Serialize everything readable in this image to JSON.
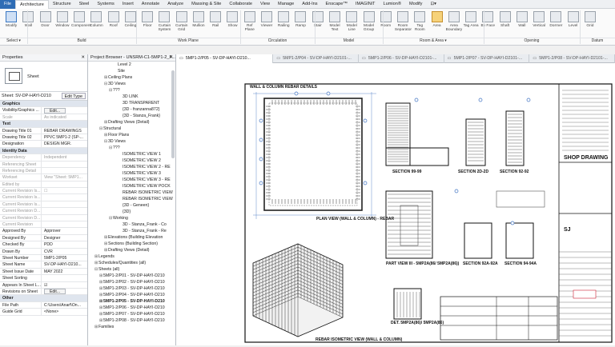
{
  "menu": [
    "File",
    "Architecture",
    "Structure",
    "Steel",
    "Systems",
    "Insert",
    "Annotate",
    "Analyze",
    "Massing & Site",
    "Collaborate",
    "View",
    "Manage",
    "Add-Ins",
    "Enscape™",
    "IMAGINiT",
    "Lumion®",
    "Modify",
    "⊡▾"
  ],
  "ribbon": {
    "tools": [
      {
        "label": "Modify"
      },
      {
        "label": "Wall"
      },
      {
        "label": "Door"
      },
      {
        "label": "Window"
      },
      {
        "label": "Component"
      },
      {
        "label": "Column"
      },
      {
        "label": "Roof"
      },
      {
        "label": "Ceiling"
      },
      {
        "label": "Floor"
      },
      {
        "label": "Curtain System"
      },
      {
        "label": "Curtain Grid"
      },
      {
        "label": "Mullion"
      },
      {
        "label": "Rail"
      },
      {
        "label": "Show"
      },
      {
        "label": "Ref Plane"
      },
      {
        "label": "Viewer"
      },
      {
        "label": "Railing"
      },
      {
        "label": "Ramp"
      },
      {
        "label": "Stair"
      },
      {
        "label": "Model Text"
      },
      {
        "label": "Model Line"
      },
      {
        "label": "Model Group"
      },
      {
        "label": "Room"
      },
      {
        "label": "Room Separator"
      },
      {
        "label": "Tag Room"
      },
      {
        "label": "Area"
      },
      {
        "label": "Area Boundary"
      },
      {
        "label": "Tag Area"
      },
      {
        "label": "By Face"
      },
      {
        "label": "Shaft"
      },
      {
        "label": "Wall"
      },
      {
        "label": "Vertical"
      },
      {
        "label": "Dormer"
      },
      {
        "label": "Level"
      },
      {
        "label": "Grid"
      }
    ],
    "groups": [
      "Select ▾",
      "Build",
      "Work Plane",
      "Circulation",
      "Model",
      "Room & Area ▾",
      "Opening",
      "Datum"
    ]
  },
  "properties": {
    "title": "Properties",
    "type_name": "Sheet",
    "selector": "Sheet: SV-DP-HAYI-D210",
    "edit_type": "Edit Type",
    "rows": [
      {
        "k": "Graphics",
        "v": "",
        "grp": true
      },
      {
        "k": "Visibility/Graphics ...",
        "v": "Edit...",
        "btn": true
      },
      {
        "k": "Scale",
        "v": "As indicated",
        "dim": true
      },
      {
        "k": "Text",
        "v": "",
        "grp": true
      },
      {
        "k": "Drawing Title 01",
        "v": "REBAR DRAWINGS"
      },
      {
        "k": "Drawing Title 02",
        "v": "PPVC 5MP1-2 (SP-..."
      },
      {
        "k": "Designation",
        "v": "DESIGN MGR."
      },
      {
        "k": "Identity Data",
        "v": "",
        "grp": true
      },
      {
        "k": "Dependency",
        "v": "Independent",
        "dim": true
      },
      {
        "k": "Referencing Sheet",
        "v": "",
        "dim": true
      },
      {
        "k": "Referencing Detail",
        "v": "",
        "dim": true
      },
      {
        "k": "Workset",
        "v": "View \"Sheet: 5MP1...",
        "dim": true
      },
      {
        "k": "Edited by",
        "v": "",
        "dim": true
      },
      {
        "k": "Current Revision Is...",
        "v": "☐",
        "dim": true
      },
      {
        "k": "Current Revision Is...",
        "v": "",
        "dim": true
      },
      {
        "k": "Current Revision Is...",
        "v": "",
        "dim": true
      },
      {
        "k": "Current Revision D...",
        "v": "",
        "dim": true
      },
      {
        "k": "Current Revision D...",
        "v": "",
        "dim": true
      },
      {
        "k": "Current Revision",
        "v": "",
        "dim": true
      },
      {
        "k": "Approved By",
        "v": "Approver"
      },
      {
        "k": "Designed By",
        "v": "Designer"
      },
      {
        "k": "Checked By",
        "v": "PDD"
      },
      {
        "k": "Drawn By",
        "v": "CVR"
      },
      {
        "k": "Sheet Number",
        "v": "5MP1-2/P05"
      },
      {
        "k": "Sheet Name",
        "v": "SV-DP-HAYI-D210..."
      },
      {
        "k": "Sheet Issue Date",
        "v": "MAY 2022"
      },
      {
        "k": "Sheet Sorting",
        "v": ""
      },
      {
        "k": "Appears In Sheet L...",
        "v": "☑"
      },
      {
        "k": "Revisions on Sheet",
        "v": "Edit...",
        "btn": true
      },
      {
        "k": "Other",
        "v": "",
        "grp": true
      },
      {
        "k": "File Path",
        "v": "C:\\Users\\Anarf\\On..."
      },
      {
        "k": "Guide Grid",
        "v": "<None>"
      }
    ]
  },
  "browser": {
    "title": "Project Browser - UNSRM-C1-5MP1-2_F...",
    "items": [
      {
        "t": "Level 2",
        "d": 5
      },
      {
        "t": "Site",
        "d": 5
      },
      {
        "t": "Ceiling Plans",
        "d": 3,
        "g": "⊞"
      },
      {
        "t": "3D Views",
        "d": 3,
        "g": "⊟"
      },
      {
        "t": "???",
        "d": 4,
        "g": "⊟"
      },
      {
        "t": "3D LINK",
        "d": 6
      },
      {
        "t": "3D TRANSPARENT",
        "d": 6
      },
      {
        "t": "{3D - franzanna872}",
        "d": 6
      },
      {
        "t": "{3D - Stanza_Frank}",
        "d": 6
      },
      {
        "t": "Drafting Views (Detail)",
        "d": 3,
        "g": "⊞"
      },
      {
        "t": "Structural",
        "d": 2,
        "g": "⊟"
      },
      {
        "t": "Floor Plans",
        "d": 3,
        "g": "⊞"
      },
      {
        "t": "3D Views",
        "d": 3,
        "g": "⊟"
      },
      {
        "t": "???",
        "d": 4,
        "g": "⊟"
      },
      {
        "t": "ISOMETRIC VIEW 1",
        "d": 6
      },
      {
        "t": "ISOMETRIC VIEW 2",
        "d": 6
      },
      {
        "t": "ISOMETRIC VIEW 2 - RE",
        "d": 6
      },
      {
        "t": "ISOMETRIC VIEW 3",
        "d": 6
      },
      {
        "t": "ISOMETRIC VIEW 3 - RE",
        "d": 6
      },
      {
        "t": "ISOMETRIC VIEW POCK",
        "d": 6
      },
      {
        "t": "REBAR ISOMETRIC VIEW",
        "d": 6
      },
      {
        "t": "REBAR ISOMETRIC VIEW",
        "d": 6
      },
      {
        "t": "{3D - Geneen}",
        "d": 6
      },
      {
        "t": "{3D}",
        "d": 6
      },
      {
        "t": "Working",
        "d": 4,
        "g": "⊟"
      },
      {
        "t": "3D - Stanza_Frank - Co",
        "d": 6
      },
      {
        "t": "3D - Stanza_Frank - Re",
        "d": 6
      },
      {
        "t": "Elevations (Building Elevation",
        "d": 3,
        "g": "⊞"
      },
      {
        "t": "Sections (Building Section)",
        "d": 3,
        "g": "⊞"
      },
      {
        "t": "Drafting Views (Detail)",
        "d": 3,
        "g": "⊞"
      },
      {
        "t": "Legends",
        "d": 1,
        "g": "⊞"
      },
      {
        "t": "Schedules/Quantities (all)",
        "d": 1,
        "g": "⊞"
      },
      {
        "t": "Sheets (all)",
        "d": 1,
        "g": "⊟"
      },
      {
        "t": "5MP1-2/P01 - SV-DP-HAYI-D210",
        "d": 2,
        "g": "⊞"
      },
      {
        "t": "5MP1-2/P02 - SV-DP-HAYI-D210",
        "d": 2,
        "g": "⊞"
      },
      {
        "t": "5MP1-2/P03 - SV-DP-HAYI-D210",
        "d": 2,
        "g": "⊞"
      },
      {
        "t": "5MP1-2/P04 - SV-DP-HAYI-D210",
        "d": 2,
        "g": "⊞"
      },
      {
        "t": "5MP1-2/P05 - SV-DP-HAYI-D210",
        "d": 2,
        "g": "⊞",
        "bold": true
      },
      {
        "t": "5MP1-2/P06 - SV-DP-HAYI-D210",
        "d": 2,
        "g": "⊞"
      },
      {
        "t": "5MP1-2/P07 - SV-DP-HAYI-D210",
        "d": 2,
        "g": "⊞"
      },
      {
        "t": "5MP1-2/P08 - SV-DP-HAYI-D210",
        "d": 2,
        "g": "⊞"
      },
      {
        "t": "Families",
        "d": 1,
        "g": "⊞"
      }
    ]
  },
  "tabs": [
    "5MP1-2/P05 - SV-DP-HAYI-D210...",
    "5MP1-2/P04 - SV-DP-HAYI-D2101-...",
    "5MP1-2/P06 - SV-DP-HAYI-D2101-...",
    "5MP1-2/P07 - SV-DP-HAYI-D2101-...",
    "5MP1-2/P08 - SV-DP-HAYI-D2101-..."
  ],
  "sheet": {
    "header": "WALL & COLUMN REBAR DETAILS",
    "labels": {
      "plan": "PLAN VIEW (WALL & COLUMN) - REBAR",
      "iso": "REBAR ISOMETRIC VIEW (WALL & COLUMN)",
      "partview": "PART VIEW III - 5MP2A(86/ 5MP2A(86))",
      "det": "DET. 5MP2A(86)/ 5MP2A(86)",
      "s1": "SECTION 99-99",
      "s2": "SECTION 2D-2D",
      "s3": "SECTION 92-92",
      "s4": "SECTION 92A-92A",
      "s5": "SECTION 94-94A",
      "scale": "SCALE 1 : 25",
      "shop": "SHOP DRAWING",
      "sj": "SJ"
    }
  }
}
